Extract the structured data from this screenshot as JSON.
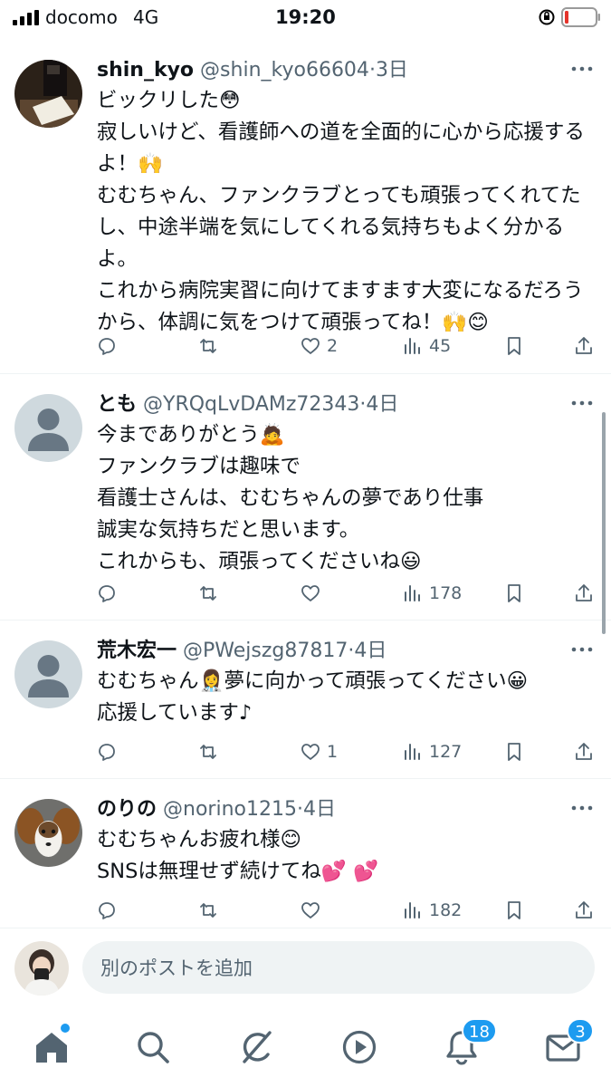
{
  "status_bar": {
    "carrier": "docomo",
    "network": "4G",
    "time": "19:20"
  },
  "posts": [
    {
      "display_name": "shin_kyo",
      "handle": "@shin_kyo66604",
      "time": "3日",
      "text": "ビックリした😳\n寂しいけど、看護師への道を全面的に心から応援するよ！🙌\nむむちゃん、ファンクラブとっても頑張ってくれてたし、中途半端を気にしてくれる気持ちもよく分かるよ。\nこれから病院実習に向けてますます大変になるだろうから、体調に気をつけて頑張ってね！🙌😊",
      "replies": "",
      "reposts": "",
      "likes": "2",
      "views": "45"
    },
    {
      "display_name": "とも",
      "handle": "@YRQqLvDAMz72343",
      "time": "4日",
      "text": "今までありがとう🙇\nファンクラブは趣味で\n看護士さんは、むむちゃんの夢であり仕事\n誠実な気持ちだと思います。\nこれからも、頑張ってくださいね😃",
      "replies": "",
      "reposts": "",
      "likes": "",
      "views": "178"
    },
    {
      "display_name": "荒木宏一",
      "handle": "@PWejszg87817",
      "time": "4日",
      "text": "むむちゃん👩‍⚕️夢に向かって頑張ってください😀\n応援しています♪",
      "replies": "",
      "reposts": "",
      "likes": "1",
      "views": "127"
    },
    {
      "display_name": "のりの",
      "handle": "@norino1215",
      "time": "4日",
      "text": "むむちゃんお疲れ様😊\nSNSは無理せず続けてね💕 💕",
      "replies": "",
      "reposts": "",
      "likes": "",
      "views": "182"
    }
  ],
  "compose": {
    "placeholder": "別のポストを追加"
  },
  "tab_bar": {
    "items": [
      {
        "icon": "home-icon"
      },
      {
        "icon": "search-icon"
      },
      {
        "icon": "grok-icon"
      },
      {
        "icon": "video-icon"
      },
      {
        "icon": "notifications-icon",
        "badge": "18"
      },
      {
        "icon": "messages-icon",
        "badge": "3"
      }
    ]
  },
  "colors": {
    "accent": "#1d9bf0",
    "text": "#0f1419",
    "muted": "#536471",
    "divider": "#eff3f4"
  }
}
